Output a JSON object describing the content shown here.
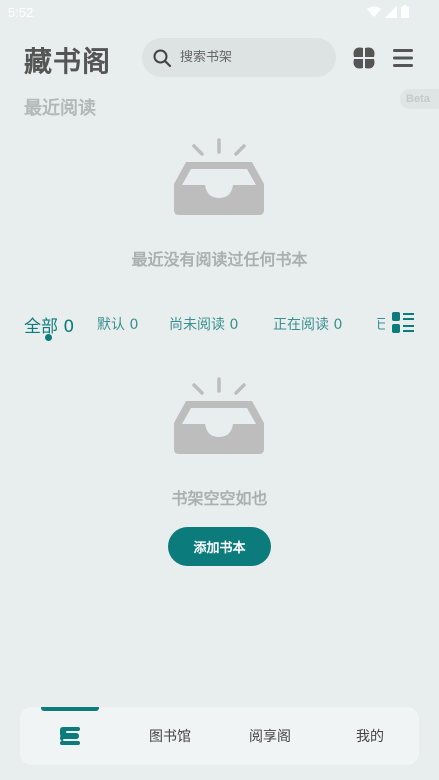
{
  "status_bar": {
    "time": "5:52"
  },
  "header": {
    "title": "藏书阁",
    "search_placeholder": "搜索书架"
  },
  "recent": {
    "title": "最近阅读",
    "badge": "Beta",
    "empty_text": "最近没有阅读过任何书本"
  },
  "tabs": [
    {
      "label": "全部 0",
      "active": true
    },
    {
      "label": "默认 0"
    },
    {
      "label": "尚未阅读 0"
    },
    {
      "label": "正在阅读 0"
    },
    {
      "label": "已"
    }
  ],
  "shelf": {
    "empty_text": "书架空空如也",
    "add_button": "添加书本"
  },
  "bottom_nav": {
    "items": [
      "图书馆",
      "阅享阁",
      "我的"
    ]
  },
  "colors": {
    "accent": "#0c7b7b",
    "background": "#e8eeee",
    "muted": "#aaafaf",
    "icon_gray": "#bdbdbd"
  },
  "icons": {
    "grid": "four-petal-grid-icon",
    "menu": "hamburger-menu-icon",
    "search": "search-icon",
    "empty": "empty-inbox-icon",
    "list_toggle": "list-view-icon",
    "shelf": "bookshelf-icon"
  }
}
